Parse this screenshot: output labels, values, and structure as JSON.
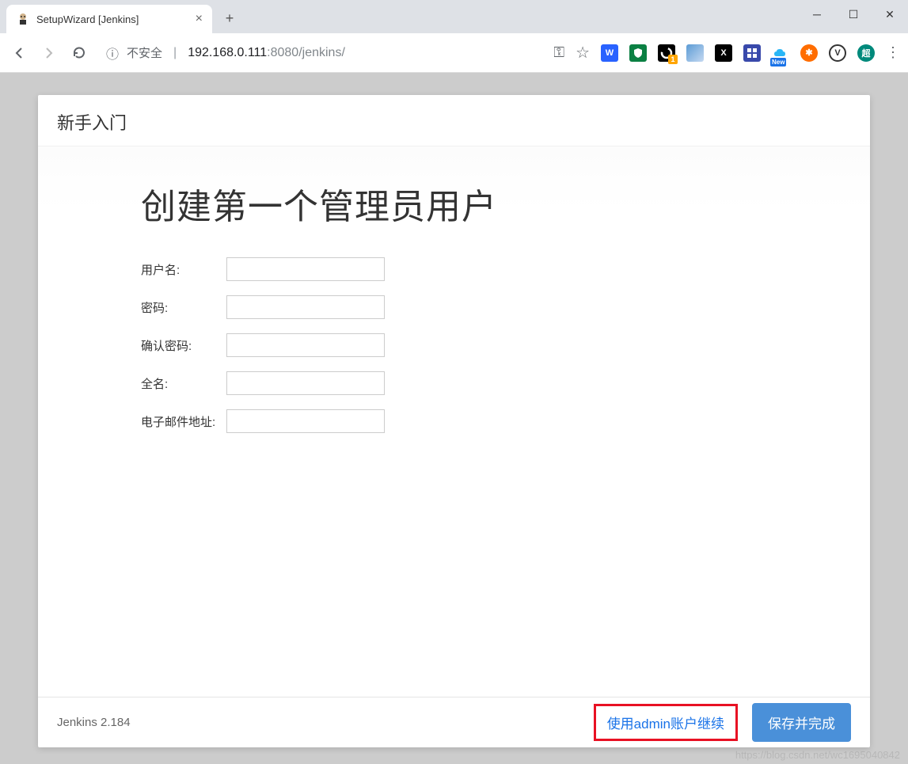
{
  "browser": {
    "tab_title": "SetupWizard [Jenkins]",
    "security_label": "不安全",
    "url_host": "192.168.0.111",
    "url_port": ":8080",
    "url_path": "/jenkins/"
  },
  "wizard": {
    "header": "新手入门",
    "title": "创建第一个管理员用户",
    "fields": {
      "username": "用户名:",
      "password": "密码:",
      "confirm_password": "确认密码:",
      "fullname": "全名:",
      "email": "电子邮件地址:"
    },
    "version": "Jenkins 2.184",
    "continue_as_admin": "使用admin账户继续",
    "save_and_finish": "保存并完成"
  },
  "watermark": "https://blog.csdn.net/wc1695040842"
}
